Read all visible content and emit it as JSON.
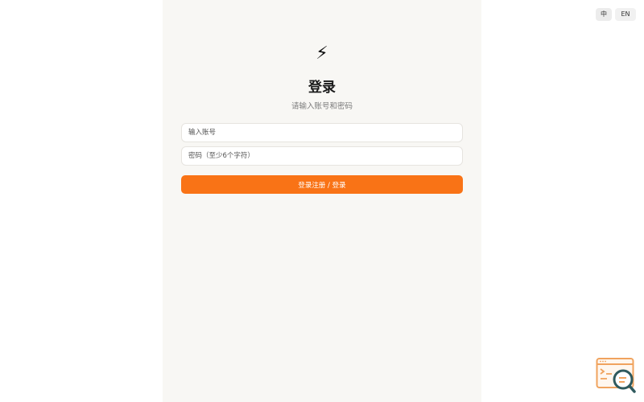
{
  "lang_switch": {
    "zh_label": "中",
    "en_label": "EN"
  },
  "logo": {
    "glyph": "⚡",
    "icon": "lightning-bolt-icon"
  },
  "title": "登录",
  "subtitle": "请输入账号和密码",
  "form": {
    "account_placeholder": "输入账号",
    "password_placeholder": "密码（至少6个字符）",
    "submit_label": "登录注册 / 登录"
  },
  "help_widget": {
    "icon": "search-help-icon"
  },
  "colors": {
    "accent": "#f97316",
    "panel_bg": "#f8f7f4",
    "help_accent": "#f0a35e",
    "help_dark": "#2f5a5e"
  }
}
